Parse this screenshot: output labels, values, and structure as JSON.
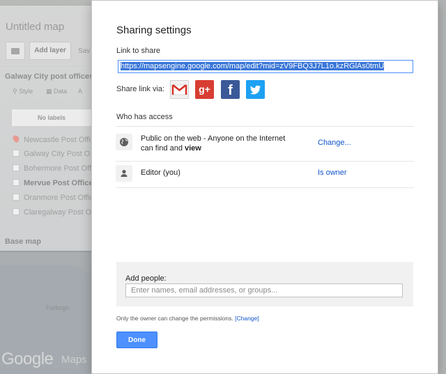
{
  "background": {
    "map_title": "Untitled map",
    "add_layer_label": "Add layer",
    "save_label": "Sav",
    "layer_title": "Galway City post offices",
    "tabs": [
      "Style",
      "Data",
      "A"
    ],
    "no_labels": "No labels",
    "items": [
      {
        "label": "Newcastle Post Offi",
        "style": "pin"
      },
      {
        "label": "Galway City Post O",
        "style": "check"
      },
      {
        "label": "Bohermore Post Offi",
        "style": "check"
      },
      {
        "label": "Mervue Post Office",
        "style": "bold"
      },
      {
        "label": "Oranmore Post Offic",
        "style": "check"
      },
      {
        "label": "Claregalway Post O",
        "style": "check"
      }
    ],
    "base_map_label": "Base map",
    "map_place_label": "Furbogh",
    "google_logo": "Google",
    "maps_word": "Maps"
  },
  "dialog": {
    "title": "Sharing settings",
    "link_label": "Link to share",
    "share_url": "https://mapsengine.google.com/map/edit?mid=zV9FBQ3J7L1o.kzRGlAs0tmU",
    "share_via_label": "Share link via:",
    "share_icons": [
      "gmail-icon",
      "google-plus-icon",
      "facebook-icon",
      "twitter-icon"
    ],
    "who_has_access_label": "Who has access",
    "access_rows": [
      {
        "icon": "globe-icon",
        "text_line1": "Public on the web - Anyone on the Internet",
        "text_line2_prefix": "can find and",
        "text_line2_bold": "view",
        "action": "Change..."
      },
      {
        "icon": "person-icon",
        "text_line1": "Editor",
        "text_you": "(you)",
        "action": "Is owner"
      }
    ],
    "add_people_label": "Add people:",
    "add_people_placeholder": "Enter names, email addresses, or groups...",
    "permissions_note": "Only the owner can change the permissions.",
    "permissions_change_link": "[Change]",
    "done_label": "Done"
  },
  "colors": {
    "primary_button": "#4d90fe",
    "link": "#1155cc",
    "selection": "#3875d7"
  }
}
